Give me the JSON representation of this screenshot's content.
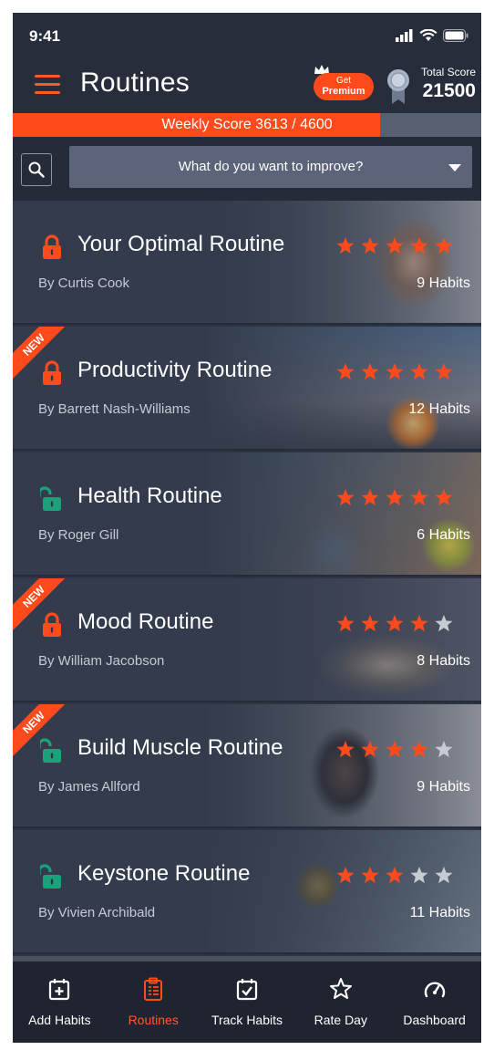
{
  "status_bar": {
    "time": "9:41"
  },
  "header": {
    "title": "Routines",
    "premium": {
      "line1": "Get",
      "line2": "Premium"
    },
    "total_score_label": "Total Score",
    "total_score_value": "21500"
  },
  "weekly_score": {
    "text": "Weekly Score  3613 / 4600",
    "fraction": 0.785
  },
  "search": {
    "dropdown_text": "What do you want to improve?"
  },
  "colors": {
    "accent": "#ff4a1c",
    "unlocked": "#1aa37a",
    "background": "#2d3444",
    "star_empty": "#c7cbd3"
  },
  "routines": [
    {
      "title": "Your Optimal Routine",
      "author": "By Curtis Cook",
      "habits": "9 Habits",
      "rating": 5,
      "locked": true,
      "is_new": false,
      "new_label": ""
    },
    {
      "title": "Productivity Routine",
      "author": "By Barrett Nash-Williams",
      "habits": "12 Habits",
      "rating": 5,
      "locked": true,
      "is_new": true,
      "new_label": "NEW"
    },
    {
      "title": "Health Routine",
      "author": "By Roger Gill",
      "habits": "6 Habits",
      "rating": 5,
      "locked": false,
      "is_new": false,
      "new_label": ""
    },
    {
      "title": "Mood Routine",
      "author": "By William Jacobson",
      "habits": "8 Habits",
      "rating": 4,
      "locked": true,
      "is_new": true,
      "new_label": "NEW"
    },
    {
      "title": "Build Muscle Routine",
      "author": "By James Allford",
      "habits": "9 Habits",
      "rating": 4,
      "locked": false,
      "is_new": true,
      "new_label": "NEW"
    },
    {
      "title": "Keystone Routine",
      "author": "By Vivien Archibald",
      "habits": "11 Habits",
      "rating": 3,
      "locked": false,
      "is_new": false,
      "new_label": ""
    }
  ],
  "tabs": [
    {
      "label": "Add Habits",
      "icon": "calendar-plus-icon",
      "active": false
    },
    {
      "label": "Routines",
      "icon": "clipboard-list-icon",
      "active": true
    },
    {
      "label": "Track Habits",
      "icon": "calendar-check-icon",
      "active": false
    },
    {
      "label": "Rate Day",
      "icon": "star-outline-icon",
      "active": false
    },
    {
      "label": "Dashboard",
      "icon": "speedometer-icon",
      "active": false
    }
  ]
}
